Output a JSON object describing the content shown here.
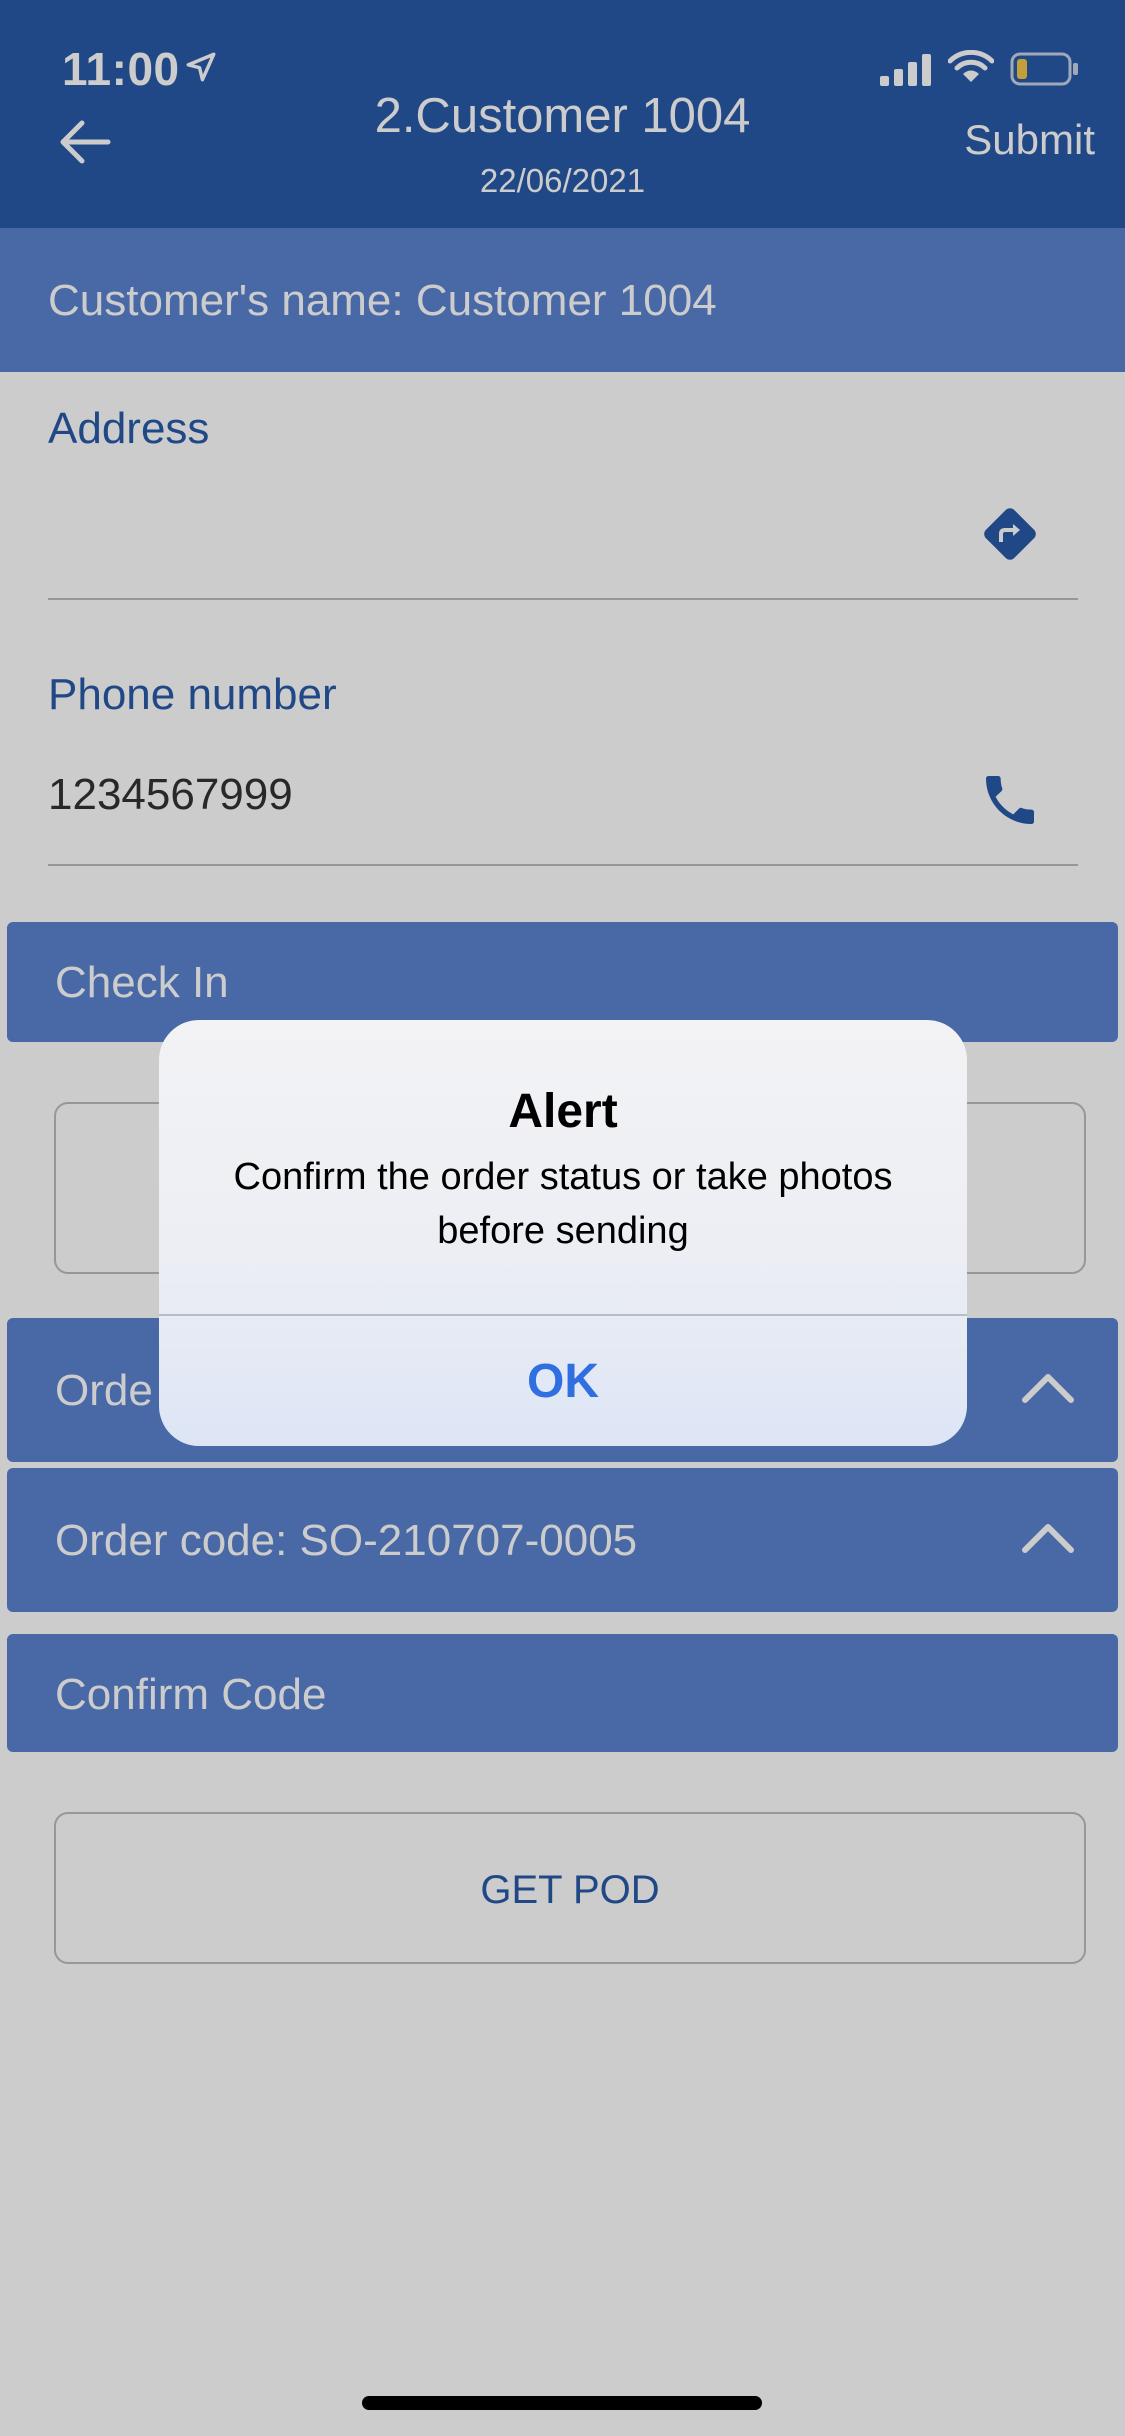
{
  "status_bar": {
    "time": "11:00"
  },
  "header": {
    "title": "2.Customer 1004",
    "date": "22/06/2021",
    "submit_label": "Submit"
  },
  "customer": {
    "name_line": "Customer's name: Customer 1004"
  },
  "address": {
    "label": "Address",
    "value": ""
  },
  "phone": {
    "label": "Phone number",
    "value": "1234567999"
  },
  "sections": {
    "check_in": "Check In",
    "order": "Orde",
    "order_code": "Order code:  SO-210707-0005",
    "confirm_code": "Confirm Code"
  },
  "get_pod_label": "GET POD",
  "alert": {
    "title": "Alert",
    "message": "Confirm the order status or take photos before sending",
    "ok_label": "OK"
  },
  "colors": {
    "header": "#2a5ba8",
    "band": "#5a83d0",
    "accent_text": "#2a5ba8",
    "alert_button": "#2f6fe0"
  },
  "icons": [
    "location-arrow-icon",
    "signal-icon",
    "wifi-icon",
    "battery-icon",
    "back-arrow-icon",
    "directions-icon",
    "phone-icon",
    "chevron-up-icon"
  ]
}
